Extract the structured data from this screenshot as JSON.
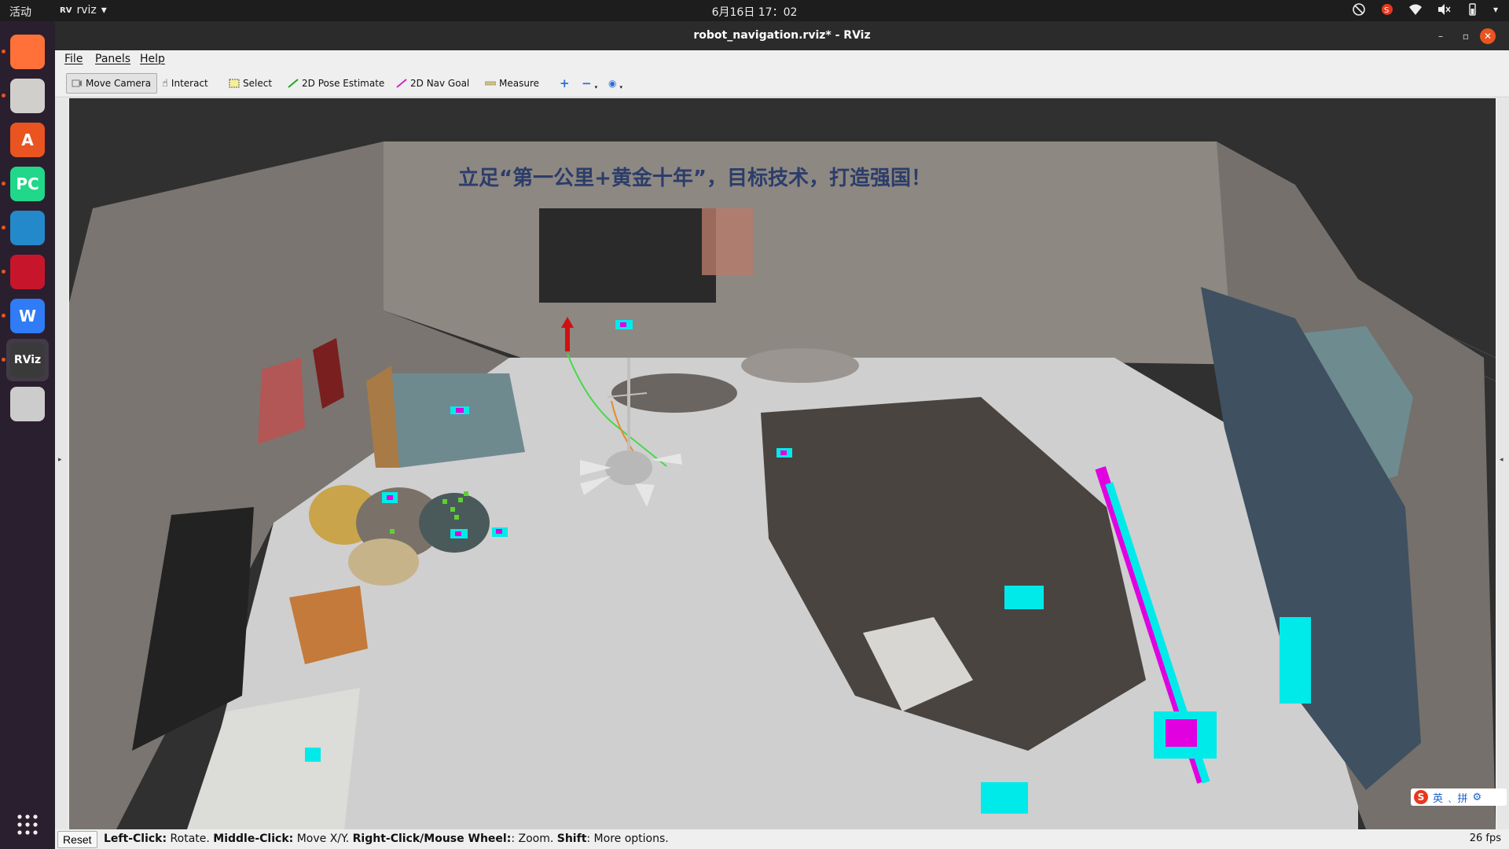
{
  "topbar": {
    "activities": "活动",
    "app_name": "rviz",
    "app_badge": "RV",
    "clock": "6月16日 17：02",
    "tray_icons": [
      "network-disabled-icon",
      "sogou-icon",
      "wifi-icon",
      "volume-muted-icon",
      "battery-icon",
      "chevron-down-icon"
    ]
  },
  "dock": {
    "items": [
      {
        "name": "firefox-icon",
        "label": "",
        "color": "#ff7139",
        "active": false,
        "running": true
      },
      {
        "name": "files-icon",
        "label": "",
        "color": "#d0cfcc",
        "active": false,
        "running": true
      },
      {
        "name": "app-store-icon",
        "label": "A",
        "color": "#e95420",
        "active": false,
        "running": false
      },
      {
        "name": "pycharm-icon",
        "label": "PC",
        "color": "#21d789",
        "active": false,
        "running": true
      },
      {
        "name": "vscode-icon",
        "label": "",
        "color": "#2489ca",
        "active": false,
        "running": true
      },
      {
        "name": "terminal-icon",
        "label": "",
        "color": "#c7162b",
        "active": false,
        "running": true
      },
      {
        "name": "wps-icon",
        "label": "W",
        "color": "#2f7cf6",
        "active": false,
        "running": true
      },
      {
        "name": "rviz-icon",
        "label": "RViz",
        "color": "#3a3a3a",
        "active": true,
        "running": true
      },
      {
        "name": "usb-drive-icon",
        "label": "",
        "color": "#cccccc",
        "active": false,
        "running": false
      }
    ],
    "show_apps_icon": "grid-icon"
  },
  "window": {
    "title": "robot_navigation.rviz* - RViz",
    "minimize": "–",
    "maximize": "▫",
    "close": "✕"
  },
  "menubar": {
    "file": "File",
    "panels": "Panels",
    "help": "Help"
  },
  "toolbar": {
    "move_camera": "Move Camera",
    "interact": "Interact",
    "select": "Select",
    "pose_estimate": "2D Pose Estimate",
    "nav_goal": "2D Nav Goal",
    "measure": "Measure",
    "colors": {
      "pose": "#23a31f",
      "goal": "#c928c9",
      "plus": "#2b6fd6"
    }
  },
  "statusbar": {
    "reset": "Reset",
    "left_click": "Left-Click:",
    "left_click_desc": " Rotate. ",
    "middle_click": "Middle-Click:",
    "middle_click_desc": " Move X/Y. ",
    "right_click": "Right-Click/Mouse Wheel:",
    "right_click_desc": ": Zoom. ",
    "shift": "Shift",
    "shift_desc": ": More options.",
    "fps": "26 fps"
  },
  "ime": {
    "logo": "S",
    "lang": "英",
    "mode": "拼",
    "icons": [
      "punctuation-icon",
      "settings-icon"
    ]
  },
  "scene": {
    "banner_text": "立足“第一公里+黄金十年”，目标技术，打造强国！",
    "colors": {
      "floor": "#cfcfcf",
      "wall": "#8a8580",
      "cyan": "#00f0f0",
      "magenta": "#e000e0",
      "grid": "#555555"
    }
  }
}
